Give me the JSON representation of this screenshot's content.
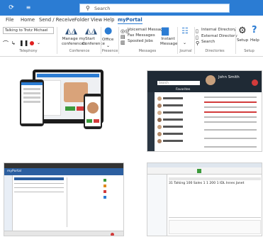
{
  "ribbon": {
    "search_placeholder": "Search",
    "menu": [
      "File",
      "Home",
      "Send / Receive",
      "Folder",
      "View",
      "Help",
      "myPortal"
    ],
    "telephony_field": "Talking to Trotz Michael",
    "groups": {
      "telephony": "Telephony",
      "conference": "Conference",
      "presence": "Presence",
      "messages": "Messages",
      "journal": "Journal",
      "directories": "Directories",
      "setup": "Setup"
    },
    "buttons": {
      "manage_conferences": "Manage my conferences",
      "start_conference": "Start Conference",
      "office": "Office",
      "voicemail": "Voicemail Messages",
      "fax": "Fax Messages",
      "spooled": "Spooled Jobs",
      "instant_message": "Instant Message",
      "internal_directory": "Internal Directory",
      "external_directory": "External Directory",
      "search": "Search",
      "setup": "Setup",
      "help": "Help"
    }
  },
  "thumb_topright": {
    "name": "John Smith",
    "heading": "Favorites",
    "search_placeholder": "Search"
  },
  "thumb_botright": {
    "row": "31  Talking  100 Sales 1   1   200 1   IDL Innes Janet"
  },
  "thumb_botleft": {
    "title": "myPortal"
  },
  "colors": {
    "blue": "#2b7cd3",
    "dark": "#1f2a35",
    "green": "#3b9a3b",
    "red": "#d23b3b"
  }
}
